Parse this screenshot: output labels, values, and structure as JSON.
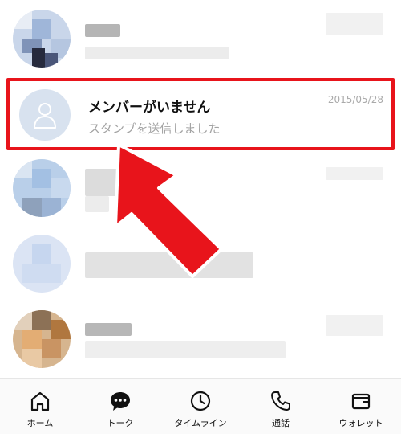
{
  "chat_list": {
    "highlighted_chat": {
      "name": "メンバーがいません",
      "preview": "スタンプを送信しました",
      "date": "2015/05/28",
      "avatar_icon": "person-placeholder-icon"
    }
  },
  "tab_bar": {
    "tabs": [
      {
        "label": "ホーム",
        "icon": "home-icon"
      },
      {
        "label": "トーク",
        "icon": "chat-bubble-icon"
      },
      {
        "label": "タイムライン",
        "icon": "clock-icon"
      },
      {
        "label": "通話",
        "icon": "phone-icon"
      },
      {
        "label": "ウォレット",
        "icon": "wallet-icon"
      }
    ]
  },
  "colors": {
    "highlight_border": "#e8141b",
    "arrow": "#e8141b",
    "avatar_placeholder": "#d8e2ef",
    "preview_text": "#a3a3a3"
  }
}
